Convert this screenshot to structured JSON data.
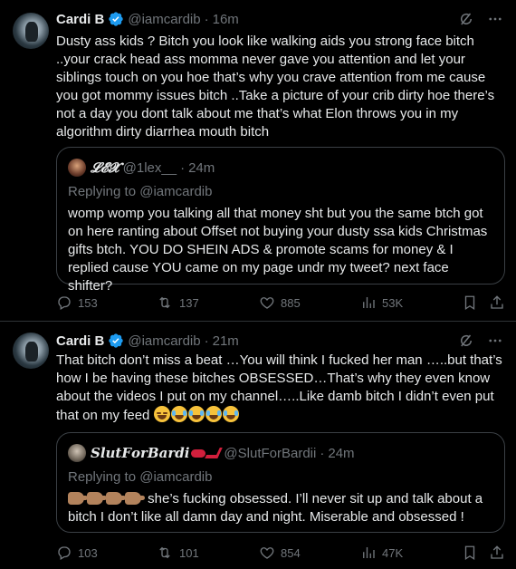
{
  "tweets": [
    {
      "name": "Cardi B",
      "handle": "@iamcardib",
      "separator": "·",
      "time": "16m",
      "text": "Dusty ass kids ? Bitch you look like walking aids you strong face bitch ..your crack head ass momma never gave you attention and let your siblings touch on you hoe that’s why you crave attention from me cause you got mommy issues bitch ..Take a picture of your crib dirty hoe there’s not a day you dont talk about me that’s what Elon throws you in my algorithm dirty diarrhea mouth bitch",
      "quote": {
        "name": "𝓛𝓔𝓧",
        "handle": "@1lex__",
        "time": "24m",
        "replying": "Replying to @iamcardib",
        "text": "womp womp you talking all that money sht but you the same btch got on here ranting about Offset not buying your dusty ssa kids Christmas gifts btch. YOU DO SHEIN ADS & promote scams for money & I replied cause YOU came on my page undr my tweet? next face shifter?"
      },
      "stats": {
        "replies": "153",
        "reposts": "137",
        "likes": "885",
        "views": "53K"
      }
    },
    {
      "name": "Cardi B",
      "handle": "@iamcardib",
      "separator": "·",
      "time": "21m",
      "text": "That bitch don’t miss a beat …You will think I fucked her man …..but that’s how I be having these bitches OBSESSED…That’s why they even know about the videos I put on my channel…..Like damb bitch I didn’t even put that on my feed",
      "quote": {
        "name": "𝑺𝒍𝒖𝒕𝑭𝒐𝒓𝑩𝒂𝒓𝒅𝒊",
        "handle": "@SlutForBardii",
        "time": "24m",
        "replying": "Replying to @iamcardib",
        "text": "she’s fucking obsessed. I’ll never sit up and talk about a bitch I don’t like all damn day and night. Miserable and obsessed !"
      },
      "stats": {
        "replies": "103",
        "reposts": "101",
        "likes": "854",
        "views": "47K"
      }
    }
  ],
  "colors": {
    "background": "#000000",
    "text": "#e7e9ea",
    "muted": "#71767b",
    "verified": "#1d9bf0",
    "border": "#2f3336"
  },
  "icons": [
    "grok-icon",
    "more-icon",
    "verified-badge-icon",
    "reply-icon",
    "repost-icon",
    "like-icon",
    "views-icon",
    "bookmark-icon",
    "share-icon"
  ]
}
